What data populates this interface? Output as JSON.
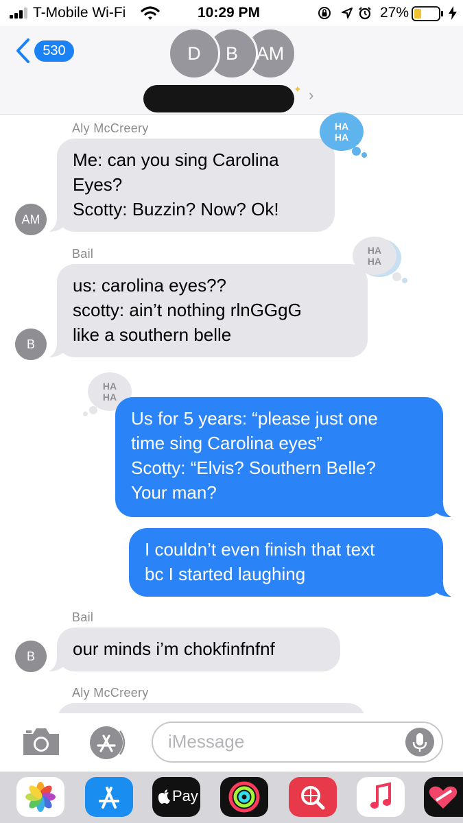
{
  "status_bar": {
    "carrier": "T-Mobile Wi-Fi",
    "time": "10:29 PM",
    "battery": "27%",
    "battery_level": 0.27
  },
  "header": {
    "back_count": "530",
    "avatars": [
      "D",
      "B",
      "AM"
    ]
  },
  "messages": [
    {
      "sender": "Aly McCreery",
      "avatar": "AM",
      "side": "left",
      "lines": [
        "Me: can you sing Carolina",
        "Eyes?",
        "Scotty: Buzzin? Now? Ok!"
      ],
      "tapback": "HA HA"
    },
    {
      "sender": "Bail",
      "avatar": "B",
      "side": "left",
      "lines": [
        "us: carolina eyes??",
        "scotty: ain’t nothing rlnGGgG",
        "like a southern belle"
      ],
      "tapback": "HA HA"
    },
    {
      "side": "right",
      "lines": [
        "Us for 5 years: “please just one",
        "time sing Carolina eyes”",
        "Scotty: “Elvis? Southern Belle?",
        "Your man?"
      ],
      "tapback": "HA HA"
    },
    {
      "side": "right",
      "lines": [
        "I couldn’t even finish that text",
        "bc I started laughing"
      ]
    },
    {
      "sender": "Bail",
      "avatar": "B",
      "side": "left",
      "lines": [
        "our minds i’m chokfinfnfnf"
      ]
    },
    {
      "sender": "Aly McCreery",
      "side": "left",
      "lines": []
    }
  ],
  "input": {
    "placeholder": "iMessage"
  },
  "app_drawer": {
    "apple_pay_label": "Pay",
    "apps": [
      "photos-icon",
      "app-store-icon",
      "apple-pay-icon",
      "activity-icon",
      "web-search-icon",
      "music-icon",
      "heart-sticker-icon"
    ]
  },
  "colors": {
    "imessage_blue": "#2b84f7",
    "received_gray": "#e6e5ea",
    "back_badge": "#1b82f6",
    "tapback_blue": "#5fb4ee",
    "tapback_gray": "#e6e5ea"
  }
}
